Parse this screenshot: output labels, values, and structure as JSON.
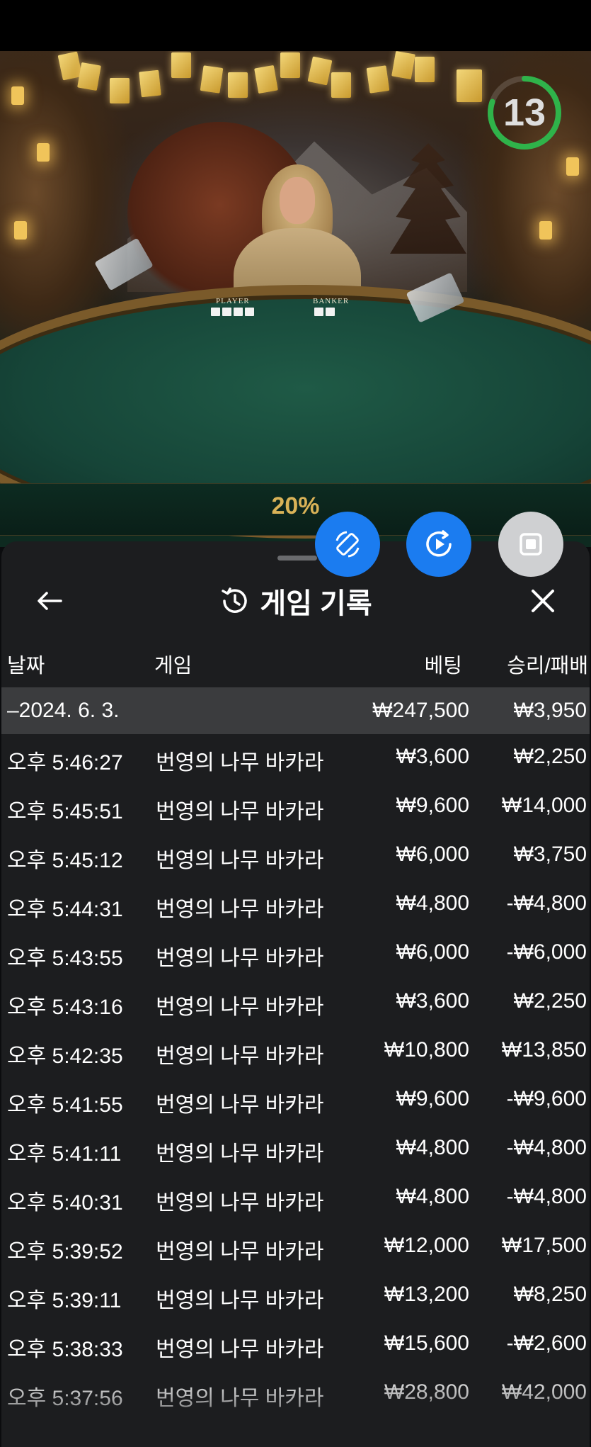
{
  "live": {
    "timer": "13",
    "table_labels": {
      "player": "PLAYER",
      "banker": "BANKER"
    },
    "promo": "20%"
  },
  "history": {
    "title": "게임 기록",
    "columns": {
      "date": "날짜",
      "game": "게임",
      "bet": "베팅",
      "result": "승리/패배"
    },
    "day": {
      "date": "–2024. 6. 3.",
      "bet": "₩247,500",
      "result": "₩3,950"
    },
    "rows": [
      {
        "time": "오후 5:46:27",
        "game": "번영의 나무 바카라",
        "bet": "₩3,600",
        "result": "₩2,250"
      },
      {
        "time": "오후 5:45:51",
        "game": "번영의 나무 바카라",
        "bet": "₩9,600",
        "result": "₩14,000"
      },
      {
        "time": "오후 5:45:12",
        "game": "번영의 나무 바카라",
        "bet": "₩6,000",
        "result": "₩3,750"
      },
      {
        "time": "오후 5:44:31",
        "game": "번영의 나무 바카라",
        "bet": "₩4,800",
        "result": "-₩4,800"
      },
      {
        "time": "오후 5:43:55",
        "game": "번영의 나무 바카라",
        "bet": "₩6,000",
        "result": "-₩6,000"
      },
      {
        "time": "오후 5:43:16",
        "game": "번영의 나무 바카라",
        "bet": "₩3,600",
        "result": "₩2,250"
      },
      {
        "time": "오후 5:42:35",
        "game": "번영의 나무 바카라",
        "bet": "₩10,800",
        "result": "₩13,850"
      },
      {
        "time": "오후 5:41:55",
        "game": "번영의 나무 바카라",
        "bet": "₩9,600",
        "result": "-₩9,600"
      },
      {
        "time": "오후 5:41:11",
        "game": "번영의 나무 바카라",
        "bet": "₩4,800",
        "result": "-₩4,800"
      },
      {
        "time": "오후 5:40:31",
        "game": "번영의 나무 바카라",
        "bet": "₩4,800",
        "result": "-₩4,800"
      },
      {
        "time": "오후 5:39:52",
        "game": "번영의 나무 바카라",
        "bet": "₩12,000",
        "result": "₩17,500"
      },
      {
        "time": "오후 5:39:11",
        "game": "번영의 나무 바카라",
        "bet": "₩13,200",
        "result": "₩8,250"
      },
      {
        "time": "오후 5:38:33",
        "game": "번영의 나무 바카라",
        "bet": "₩15,600",
        "result": "-₩2,600"
      },
      {
        "time": "오후 5:37:56",
        "game": "번영의 나무 바카라",
        "bet": "₩28,800",
        "result": "₩42,000"
      }
    ]
  },
  "colors": {
    "fab_blue": "#1b7cf0",
    "fab_gray": "#cfd0d2",
    "timer_ring": "#2fb34a",
    "sheet_bg": "#1c1d1f",
    "date_row_bg": "#3b3c3e",
    "promo_gold": "#d9b257"
  },
  "icons": {
    "back": "arrow-left-icon",
    "history": "history-clock-icon",
    "close": "close-icon",
    "fab1": "rotate-phone-icon",
    "fab2": "replay-video-icon",
    "fab3": "stop-square-icon"
  }
}
